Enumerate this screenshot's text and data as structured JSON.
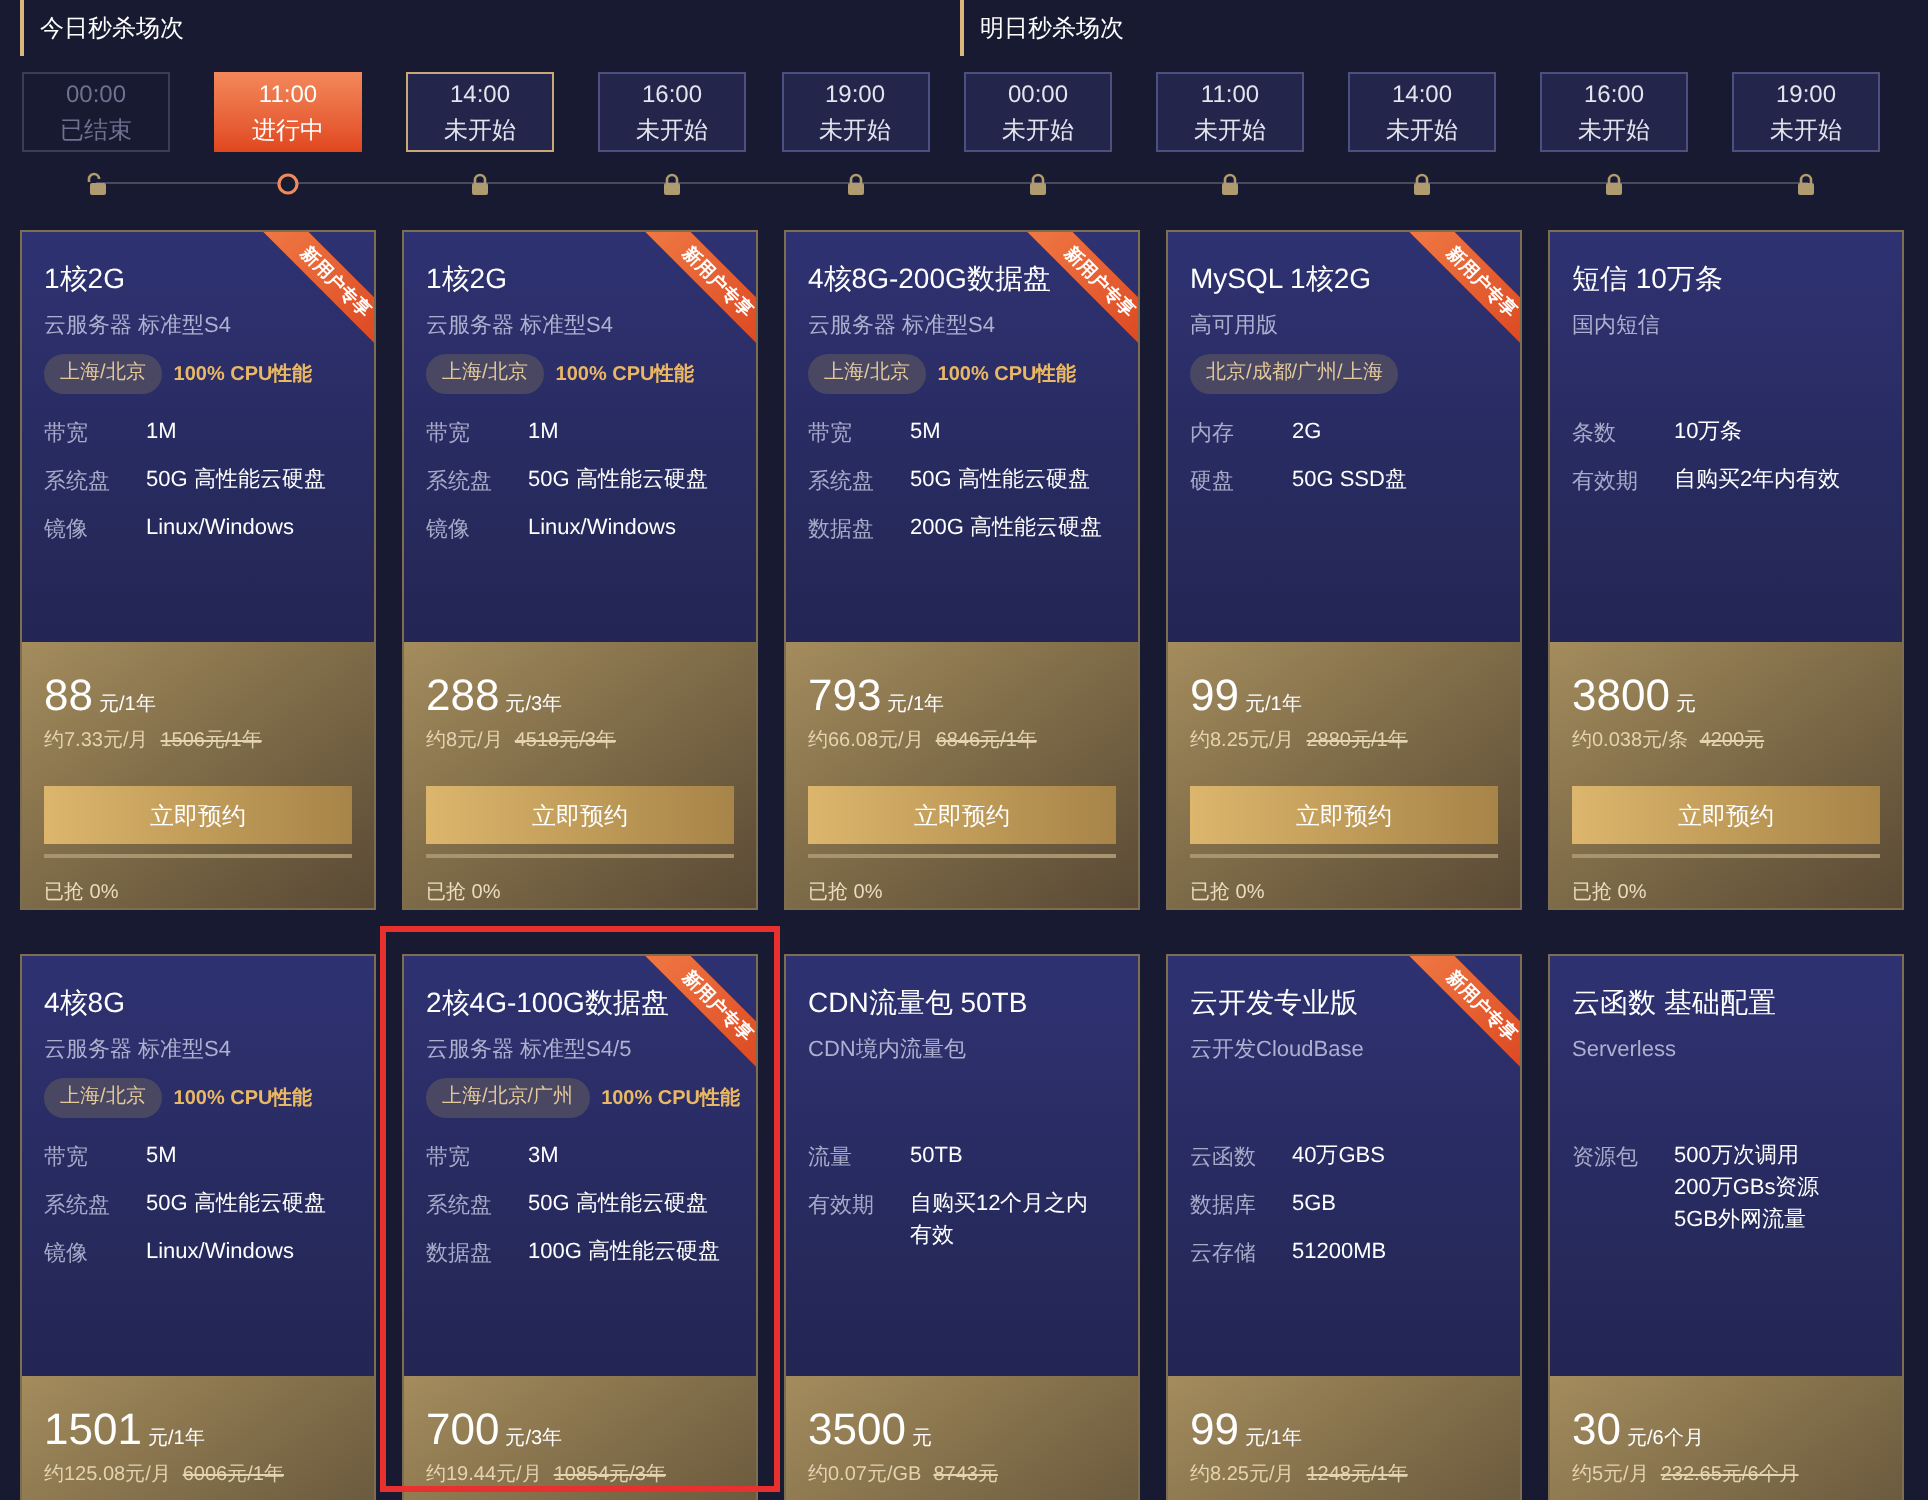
{
  "session_groups": [
    {
      "heading": "今日秒杀场次",
      "sessions": [
        {
          "time": "00:00",
          "label": "已结束",
          "kind": "ended",
          "focused": false
        },
        {
          "time": "11:00",
          "label": "进行中",
          "kind": "active",
          "focused": false
        },
        {
          "time": "14:00",
          "label": "未开始",
          "kind": "upcoming",
          "focused": true
        },
        {
          "time": "16:00",
          "label": "未开始",
          "kind": "upcoming",
          "focused": false
        },
        {
          "time": "19:00",
          "label": "未开始",
          "kind": "upcoming",
          "focused": false
        }
      ]
    },
    {
      "heading": "明日秒杀场次",
      "sessions": [
        {
          "time": "00:00",
          "label": "未开始",
          "kind": "upcoming",
          "focused": false
        },
        {
          "time": "11:00",
          "label": "未开始",
          "kind": "upcoming",
          "focused": false
        },
        {
          "time": "14:00",
          "label": "未开始",
          "kind": "upcoming",
          "focused": false
        },
        {
          "time": "16:00",
          "label": "未开始",
          "kind": "upcoming",
          "focused": false
        },
        {
          "time": "19:00",
          "label": "未开始",
          "kind": "upcoming",
          "focused": false
        }
      ]
    }
  ],
  "cards": [
    {
      "title": "1核2G",
      "subtitle": "云服务器 标准型S4",
      "ribbon": "新用户专享",
      "region": "上海/北京",
      "cpu": "100% CPU性能",
      "specs": [
        {
          "label": "带宽",
          "lines": [
            "1M"
          ]
        },
        {
          "label": "系统盘",
          "lines": [
            "50G 高性能云硬盘"
          ]
        },
        {
          "label": "镜像",
          "lines": [
            "Linux/Windows"
          ]
        }
      ],
      "price": "88",
      "unit": "元/1年",
      "per": "约7.33元/月",
      "original": "1506元/1年",
      "button": "立即预约",
      "sold": "已抢 0%",
      "highlighted": false
    },
    {
      "title": "1核2G",
      "subtitle": "云服务器 标准型S4",
      "ribbon": "新用户专享",
      "region": "上海/北京",
      "cpu": "100% CPU性能",
      "specs": [
        {
          "label": "带宽",
          "lines": [
            "1M"
          ]
        },
        {
          "label": "系统盘",
          "lines": [
            "50G 高性能云硬盘"
          ]
        },
        {
          "label": "镜像",
          "lines": [
            "Linux/Windows"
          ]
        }
      ],
      "price": "288",
      "unit": "元/3年",
      "per": "约8元/月",
      "original": "4518元/3年",
      "button": "立即预约",
      "sold": "已抢 0%",
      "highlighted": false
    },
    {
      "title": "4核8G-200G数据盘",
      "subtitle": "云服务器 标准型S4",
      "ribbon": "新用户专享",
      "region": "上海/北京",
      "cpu": "100% CPU性能",
      "specs": [
        {
          "label": "带宽",
          "lines": [
            "5M"
          ]
        },
        {
          "label": "系统盘",
          "lines": [
            "50G 高性能云硬盘"
          ]
        },
        {
          "label": "数据盘",
          "lines": [
            "200G 高性能云硬盘"
          ]
        }
      ],
      "price": "793",
      "unit": "元/1年",
      "per": "约66.08元/月",
      "original": "6846元/1年",
      "button": "立即预约",
      "sold": "已抢 0%",
      "highlighted": false
    },
    {
      "title": "MySQL 1核2G",
      "subtitle": "高可用版",
      "ribbon": "新用户专享",
      "region": "北京/成都/广州/上海",
      "specs": [
        {
          "label": "内存",
          "lines": [
            "2G"
          ]
        },
        {
          "label": "硬盘",
          "lines": [
            "50G SSD盘"
          ]
        }
      ],
      "price": "99",
      "unit": "元/1年",
      "per": "约8.25元/月",
      "original": "2880元/1年",
      "button": "立即预约",
      "sold": "已抢 0%",
      "highlighted": false
    },
    {
      "title": "短信 10万条",
      "subtitle": "国内短信",
      "specs": [
        {
          "label": "条数",
          "lines": [
            "10万条"
          ]
        },
        {
          "label": "有效期",
          "lines": [
            "自购买2年内有效"
          ]
        }
      ],
      "price": "3800",
      "unit": "元",
      "per": "约0.038元/条",
      "original": "4200元",
      "button": "立即预约",
      "sold": "已抢 0%",
      "highlighted": false
    },
    {
      "title": "4核8G",
      "subtitle": "云服务器 标准型S4",
      "region": "上海/北京",
      "cpu": "100% CPU性能",
      "specs": [
        {
          "label": "带宽",
          "lines": [
            "5M"
          ]
        },
        {
          "label": "系统盘",
          "lines": [
            "50G 高性能云硬盘"
          ]
        },
        {
          "label": "镜像",
          "lines": [
            "Linux/Windows"
          ]
        }
      ],
      "price": "1501",
      "unit": "元/1年",
      "per": "约125.08元/月",
      "original": "6006元/1年",
      "highlighted": false
    },
    {
      "title": "2核4G-100G数据盘",
      "subtitle": "云服务器 标准型S4/5",
      "ribbon": "新用户专享",
      "region": "上海/北京/广州",
      "cpu": "100% CPU性能",
      "specs": [
        {
          "label": "带宽",
          "lines": [
            "3M"
          ]
        },
        {
          "label": "系统盘",
          "lines": [
            "50G 高性能云硬盘"
          ]
        },
        {
          "label": "数据盘",
          "lines": [
            "100G 高性能云硬盘"
          ]
        }
      ],
      "price": "700",
      "unit": "元/3年",
      "per": "约19.44元/月",
      "original": "10854元/3年",
      "highlighted": true
    },
    {
      "title": "CDN流量包 50TB",
      "subtitle": "CDN境内流量包",
      "specs": [
        {
          "label": "流量",
          "lines": [
            "50TB"
          ]
        },
        {
          "label": "有效期",
          "lines": [
            "自购买12个月之内",
            "有效"
          ]
        }
      ],
      "price": "3500",
      "unit": "元",
      "per": "约0.07元/GB",
      "original": "8743元",
      "highlighted": false
    },
    {
      "title": "云开发专业版",
      "subtitle": "云开发CloudBase",
      "ribbon": "新用户专享",
      "specs": [
        {
          "label": "云函数",
          "lines": [
            "40万GBS"
          ]
        },
        {
          "label": "数据库",
          "lines": [
            "5GB"
          ]
        },
        {
          "label": "云存储",
          "lines": [
            "51200MB"
          ]
        }
      ],
      "price": "99",
      "unit": "元/1年",
      "per": "约8.25元/月",
      "original": "1248元/1年",
      "highlighted": false
    },
    {
      "title": "云函数 基础配置",
      "subtitle": "Serverless",
      "specs": [
        {
          "label": "资源包",
          "lines": [
            "500万次调用",
            "200万GBs资源",
            "5GB外网流量"
          ]
        }
      ],
      "price": "30",
      "unit": "元/6个月",
      "per": "约5元/月",
      "original": "232.65元/6个月",
      "highlighted": false
    }
  ]
}
